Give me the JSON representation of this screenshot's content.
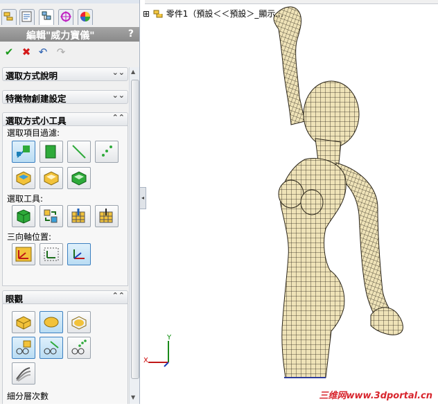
{
  "feature_title": "編輯\"威力寶儀\"",
  "help_label": "?",
  "sections": {
    "selection_help": "選取方式說明",
    "feature_creation": "特徵物創建設定",
    "selection_tools": "選取方式小工具",
    "display": "眼觀"
  },
  "labels": {
    "selection_filter": "選取項目過濾:",
    "selection_tool": "選取工具:",
    "triad_position": "三向軸位置:",
    "subdivision_level": "細分層次數"
  },
  "tree": {
    "expand": "⊞",
    "item": "零件1（預設＜＜預設＞_顯示..."
  },
  "triad": {
    "x": "X",
    "y": "Y"
  },
  "watermark": "三维网www.3dportal.cn",
  "colors": {
    "accent": "#3b7fc0",
    "mesh_fill": "#efe3b8",
    "mesh_line": "#2a2418",
    "title_bar": "#999999"
  }
}
